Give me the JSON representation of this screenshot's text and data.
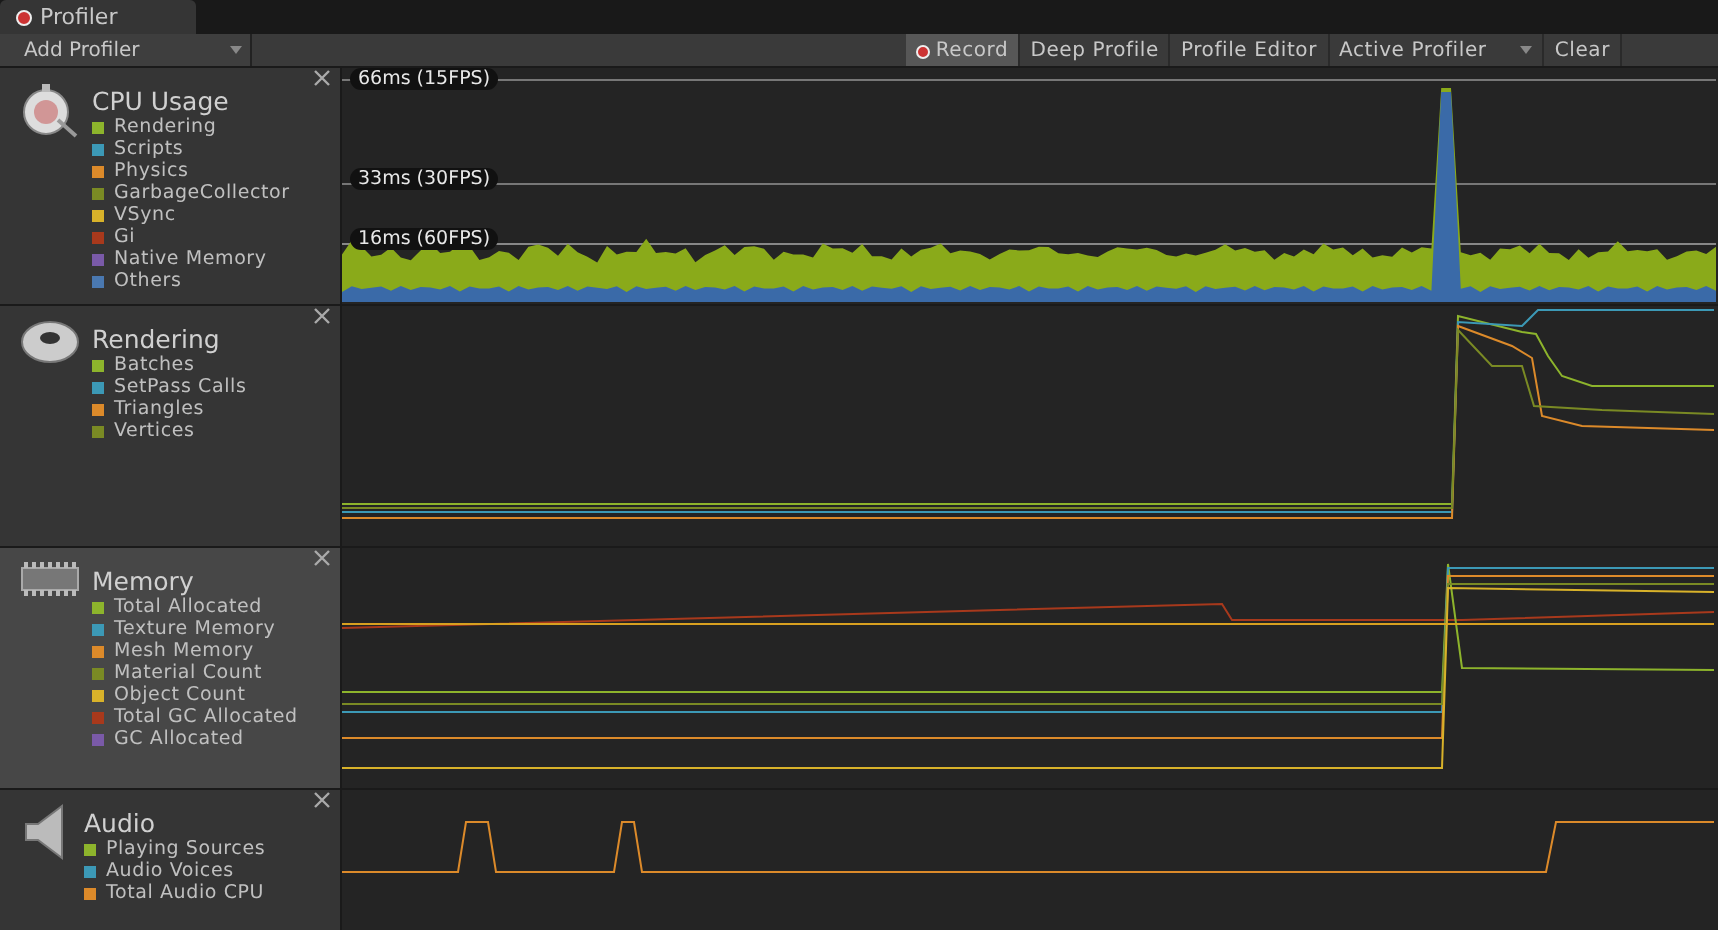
{
  "window": {
    "title": "Profiler"
  },
  "toolbar": {
    "add_profiler": "Add Profiler",
    "buttons": [
      {
        "label": "Record",
        "kind": "toggle",
        "selected": true
      },
      {
        "label": "Deep Profile",
        "kind": "toggle",
        "selected": false
      },
      {
        "label": "Profile Editor",
        "kind": "toggle",
        "selected": false
      },
      {
        "label": "Active Profiler",
        "kind": "dropdown",
        "selected": false
      },
      {
        "label": "Clear",
        "kind": "button",
        "selected": false
      }
    ]
  },
  "modules": [
    {
      "kind": "cpu",
      "title": "CPU Usage",
      "selected": false,
      "thresholds": [
        "66ms (15FPS)",
        "33ms (30FPS)",
        "16ms (60FPS)"
      ],
      "legend": [
        {
          "label": "Rendering",
          "color": "#8db42c"
        },
        {
          "label": "Scripts",
          "color": "#3c99b6"
        },
        {
          "label": "Physics",
          "color": "#dc8a2a"
        },
        {
          "label": "GarbageCollector",
          "color": "#7a8a24"
        },
        {
          "label": "VSync",
          "color": "#d8b22a"
        },
        {
          "label": "Gi",
          "color": "#a8391c"
        },
        {
          "label": "Native Memory",
          "color": "#7a5aa8"
        },
        {
          "label": "Others",
          "color": "#4a78b0"
        }
      ]
    },
    {
      "kind": "rendering",
      "title": "Rendering",
      "selected": false,
      "legend": [
        {
          "label": "Batches",
          "color": "#8db42c"
        },
        {
          "label": "SetPass Calls",
          "color": "#3c99b6"
        },
        {
          "label": "Triangles",
          "color": "#dc8a2a"
        },
        {
          "label": "Vertices",
          "color": "#7a8a24"
        }
      ]
    },
    {
      "kind": "memory",
      "title": "Memory",
      "selected": true,
      "legend": [
        {
          "label": "Total Allocated",
          "color": "#8db42c"
        },
        {
          "label": "Texture Memory",
          "color": "#3c99b6"
        },
        {
          "label": "Mesh Memory",
          "color": "#dc8a2a"
        },
        {
          "label": "Material Count",
          "color": "#7a8a24"
        },
        {
          "label": "Object Count",
          "color": "#d8b22a"
        },
        {
          "label": "Total GC Allocated",
          "color": "#a8391c"
        },
        {
          "label": "GC Allocated",
          "color": "#7a5aa8"
        }
      ]
    },
    {
      "kind": "audio",
      "title": "Audio",
      "selected": false,
      "legend": [
        {
          "label": "Playing Sources",
          "color": "#8db42c"
        },
        {
          "label": "Audio Voices",
          "color": "#3c99b6"
        },
        {
          "label": "Total Audio CPU",
          "color": "#dc8a2a"
        }
      ]
    }
  ]
}
